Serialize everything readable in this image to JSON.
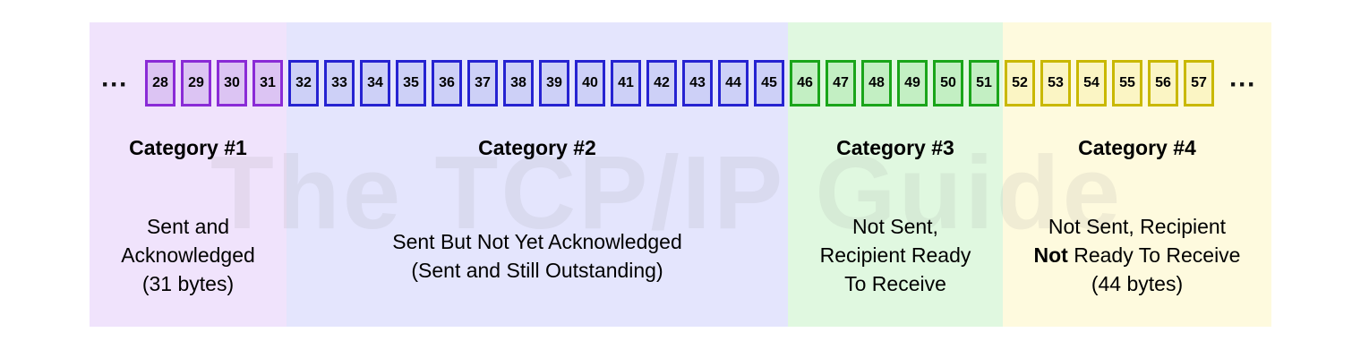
{
  "diagram": {
    "watermark": "The TCP/IP Guide",
    "ellipsis": "···",
    "categories": [
      {
        "title": "Category #1",
        "bytes": [
          "28",
          "29",
          "30",
          "31"
        ],
        "color": "#8a2bd6",
        "fill": "#dcc4f3",
        "background": "#f0e3fc",
        "description": [
          "Sent and",
          "Acknowledged",
          "(31 bytes)"
        ]
      },
      {
        "title": "Category #2",
        "bytes": [
          "32",
          "33",
          "34",
          "35",
          "36",
          "37",
          "38",
          "39",
          "40",
          "41",
          "42",
          "43",
          "44",
          "45"
        ],
        "color": "#2623d1",
        "fill": "#cdd0f7",
        "background": "#e4e5fd",
        "description": [
          "Sent But Not Yet Acknowledged",
          "(Sent and Still Outstanding)"
        ]
      },
      {
        "title": "Category #3",
        "bytes": [
          "46",
          "47",
          "48",
          "49",
          "50",
          "51"
        ],
        "color": "#1aa51a",
        "fill": "#c3efc3",
        "background": "#e0f8e0",
        "description": [
          "Not Sent,",
          "Recipient Ready",
          "To Receive"
        ]
      },
      {
        "title": "Category #4",
        "bytes": [
          "52",
          "53",
          "54",
          "55",
          "56",
          "57"
        ],
        "color": "#c9b800",
        "fill": "#fbf5c4",
        "background": "#fefade",
        "description_line1": "Not Sent, Recipient",
        "description_line2_bold": "Not",
        "description_line2_rest": " Ready To Receive",
        "description_line3": "(44 bytes)"
      }
    ]
  }
}
